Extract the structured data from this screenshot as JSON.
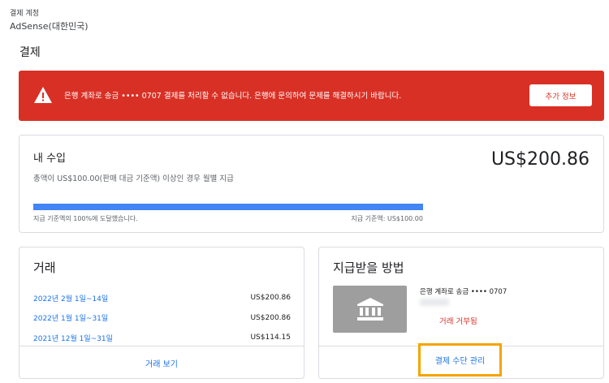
{
  "header": {
    "account_label": "결제 계정",
    "account_name": "AdSense(대한민국)",
    "page_title": "결제"
  },
  "alert": {
    "message": "은행 계좌로 송금 •••• 0707 결제를 처리할 수 없습니다. 은행에 문의하여 문제를 해결하시기 바랍니다.",
    "button_label": "추가 정보",
    "color": "#d93025",
    "icon": "warning-icon"
  },
  "earnings": {
    "title": "내 수입",
    "amount": "US$200.86",
    "description": "총액이 US$100.00(판매 대금 기준액) 이상인 경우 월별 지급",
    "progress_percent": 100,
    "progress_left_label": "지급 기준액의 100%에 도달했습니다.",
    "progress_right_label": "지급 기준액: US$100.00",
    "progress_color": "#4285f4"
  },
  "transactions": {
    "title": "거래",
    "rows": [
      {
        "date": "2022년 2월 1일~14일",
        "amount": "US$200.86"
      },
      {
        "date": "2022년 1월 1일~31일",
        "amount": "US$200.86"
      },
      {
        "date": "2021년 12월 1일~31일",
        "amount": "US$114.15"
      }
    ],
    "footer_link": "거래 보기"
  },
  "payment_method": {
    "title": "지급받을 방법",
    "method_name": "은행 계좌로 송금 •••• 0707",
    "status": "거래 거부됨",
    "status_color": "#d93025",
    "icon": "bank-icon",
    "manage_link": "결제 수단 관리",
    "highlight_color": "#f5a400"
  }
}
